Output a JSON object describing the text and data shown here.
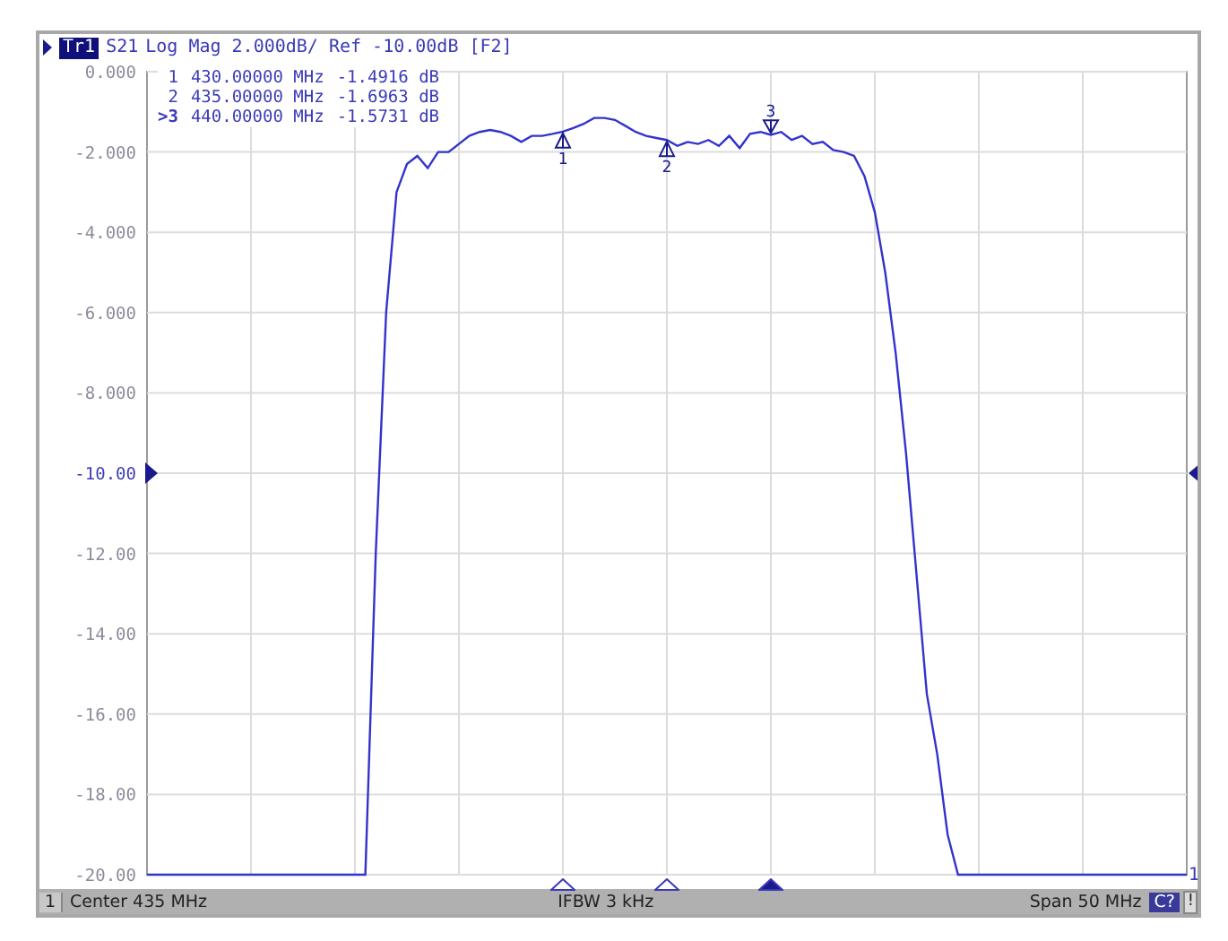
{
  "header": {
    "trace": "Tr1",
    "title": "Log Mag 2.000dB/ Ref -10.00dB [F2]"
  },
  "markers": [
    {
      "label": "1",
      "flag": "1",
      "stimulus": "430.00000 MHz",
      "response": "-1.4916 dB",
      "level": 0.4,
      "selected": false
    },
    {
      "label": "2",
      "flag": "2",
      "stimulus": "435.00000 MHz",
      "response": "-1.6963 dB",
      "level": 0.5,
      "selected": false
    },
    {
      "label": ">3",
      "flag": "3",
      "stimulus": "440.00000 MHz",
      "response": "-1.5731 dB",
      "level": 0.6,
      "selected": true
    }
  ],
  "chart_data": {
    "type": "line",
    "grid": true,
    "ylim": [
      -20,
      0
    ],
    "yticks": [
      {
        "value": 0,
        "label": "0.000"
      },
      {
        "value": -2,
        "label": "-2.000"
      },
      {
        "value": -4,
        "label": "-4.000"
      },
      {
        "value": -6,
        "label": "-6.000"
      },
      {
        "value": -8,
        "label": "-8.000"
      },
      {
        "value": -10,
        "label": "-10.00"
      },
      {
        "value": -12,
        "label": "-12.00"
      },
      {
        "value": -14,
        "label": "-14.00"
      },
      {
        "value": -16,
        "label": "-16.00"
      },
      {
        "value": -18,
        "label": "-18.00"
      },
      {
        "value": -20,
        "label": "-20.00"
      }
    ],
    "categories": [
      null,
      null,
      null,
      null,
      null,
      null,
      null,
      null,
      null,
      null,
      null,
      null,
      null,
      null,
      null,
      null,
      null,
      null,
      null,
      null,
      null,
      null,
      null,
      null,
      null,
      null,
      null,
      null,
      null,
      null,
      null,
      null,
      null,
      null,
      null,
      null,
      null,
      null,
      null,
      null,
      null,
      null,
      null,
      null,
      null,
      null,
      null,
      null,
      null,
      null,
      null,
      null,
      null,
      null,
      null,
      null,
      null,
      null,
      null,
      null,
      null,
      null,
      null,
      null,
      null,
      null,
      null,
      null,
      null,
      null,
      null,
      null,
      null,
      null,
      null,
      null,
      null,
      null,
      null,
      null,
      null,
      null,
      null,
      null,
      null,
      null,
      null,
      null,
      null,
      null,
      null,
      null,
      null,
      null,
      null,
      null,
      null,
      null,
      null,
      null,
      null
    ],
    "series": [
      {
        "name": "S21",
        "color": "#3333cc",
        "values": [
          -20,
          -20,
          -20,
          -20,
          -20,
          -20,
          -20,
          -20,
          -20,
          -20,
          -20,
          -20,
          -20,
          -20,
          -20,
          -20,
          -20,
          -20,
          -20,
          -20,
          -20,
          -20,
          -12,
          -6,
          -3,
          -2.3,
          -2.1,
          -2.4,
          -2.0,
          -2.0,
          -1.8,
          -1.6,
          -1.5,
          -1.45,
          -1.5,
          -1.6,
          -1.75,
          -1.6,
          -1.6,
          -1.55,
          -1.49,
          -1.4,
          -1.3,
          -1.15,
          -1.15,
          -1.2,
          -1.35,
          -1.5,
          -1.6,
          -1.65,
          -1.7,
          -1.85,
          -1.75,
          -1.8,
          -1.7,
          -1.85,
          -1.6,
          -1.9,
          -1.55,
          -1.5,
          -1.57,
          -1.5,
          -1.7,
          -1.6,
          -1.8,
          -1.75,
          -1.95,
          -2.0,
          -2.1,
          -2.6,
          -3.5,
          -5.0,
          -7.0,
          -9.5,
          -12.5,
          -15.5,
          -17.0,
          -19.0,
          -20,
          -20,
          -20,
          -20,
          -20,
          -20,
          -20,
          -20,
          -20,
          -20,
          -20,
          -20,
          -20,
          -20,
          -20,
          -20,
          -20,
          -20,
          -20,
          -20,
          -20,
          -20,
          -20
        ]
      }
    ]
  },
  "trace_end_label": "1",
  "status_bar": {
    "channel": "1",
    "left": "Center 435 MHz",
    "middle": "IFBW 3 kHz",
    "right": "Span 50 MHz",
    "calibration": "C?",
    "alert": "!"
  }
}
